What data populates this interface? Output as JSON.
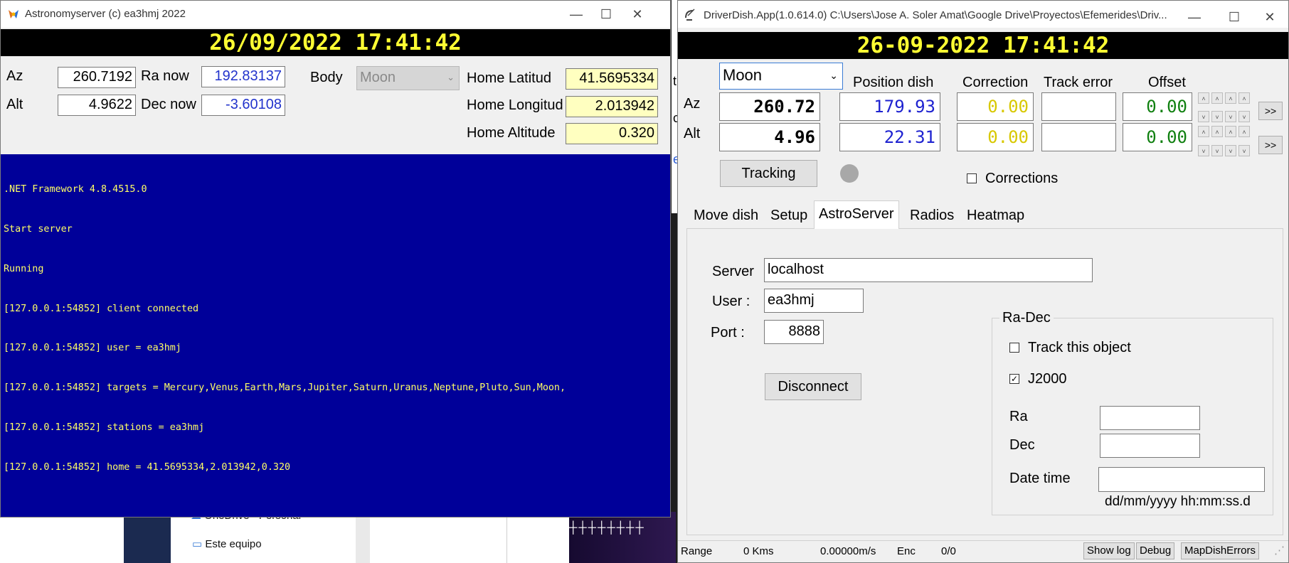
{
  "background": {
    "explorer_items": [
      "OneDrive - Personal",
      "Este equipo"
    ],
    "behind_text_letters": [
      "t",
      "c",
      "e"
    ]
  },
  "astro_window": {
    "title": "Astronomyserver (c) ea3hmj 2022",
    "clock": "26/09/2022 17:41:42",
    "labels": {
      "az": "Az",
      "alt": "Alt",
      "ra_now": "Ra now",
      "dec_now": "Dec now",
      "body": "Body",
      "home_lat": "Home Latitud",
      "home_lon": "Home Longitud",
      "home_alt": "Home Altitude"
    },
    "values": {
      "az": "260.7192",
      "alt": "4.9622",
      "ra_now": "192.83137",
      "dec_now": "-3.60108",
      "body": "Moon",
      "home_lat": "41.5695334",
      "home_lon": "2.013942",
      "home_alt": "0.320"
    },
    "console": [
      ".NET Framework 4.8.4515.0",
      "Start server",
      "Running",
      "[127.0.0.1:54852] client connected",
      "[127.0.0.1:54852] user = ea3hmj",
      "[127.0.0.1:54852] targets = Mercury,Venus,Earth,Mars,Jupiter,Saturn,Uranus,Neptune,Pluto,Sun,Moon,",
      "[127.0.0.1:54852] stations = ea3hmj",
      "[127.0.0.1:54852] home = 41.5695334,2.013942,0.320"
    ],
    "colors": {
      "console_bg": "#000099",
      "console_fg": "#ffff66",
      "clock_fg": "#ffff33"
    }
  },
  "dish_window": {
    "title": "DriverDish.App(1.0.614.0) C:\\Users\\Jose A. Soler Amat\\Google Drive\\Proyectos\\Efemerides\\Driv...",
    "clock": "26-09-2022 17:41:42",
    "target": "Moon",
    "headers": {
      "position": "Position dish",
      "correction": "Correction",
      "track_error": "Track error",
      "offset": "Offset"
    },
    "rows": [
      {
        "label": "Az",
        "target": "260.72",
        "position": "179.93",
        "correction": "0.00",
        "track_error": "",
        "offset": "0.00",
        "go": ">>"
      },
      {
        "label": "Alt",
        "target": "4.96",
        "position": "22.31",
        "correction": "0.00",
        "track_error": "",
        "offset": "0.00",
        "go": ">>"
      }
    ],
    "tracking_label": "Tracking",
    "corrections_label": "Corrections",
    "tabs": [
      "Move dish",
      "Setup",
      "AstroServer",
      "Radios",
      "Heatmap"
    ],
    "active_tab": "AstroServer",
    "astroserver": {
      "server_label": "Server",
      "server_value": "localhost",
      "user_label": "User :",
      "user_value": "ea3hmj",
      "port_label": "Port :",
      "port_value": "8888",
      "disconnect_label": "Disconnect",
      "radec_title": "Ra-Dec",
      "track_label": "Track this object",
      "j2000_label": "J2000",
      "ra_label": "Ra",
      "dec_label": "Dec",
      "datetime_label": "Date time",
      "datetime_hint": "dd/mm/yyyy hh:mm:ss.d"
    },
    "status": {
      "range_label": "Range",
      "range_value": "0 Kms",
      "speed": "0.00000m/s",
      "enc_label": "Enc",
      "enc_value": "0/0",
      "buttons": [
        "Show log",
        "Debug",
        "MapDishErrors"
      ]
    }
  }
}
